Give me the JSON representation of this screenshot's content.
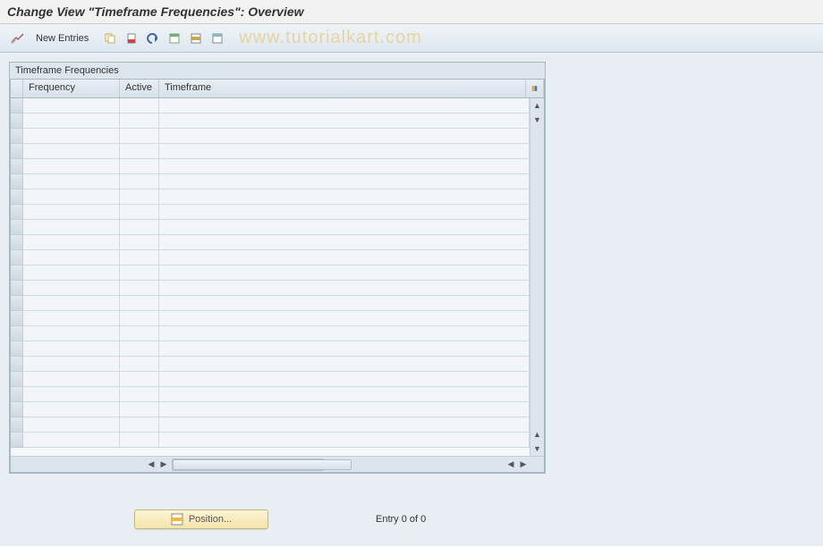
{
  "title": "Change View \"Timeframe Frequencies\": Overview",
  "toolbar": {
    "new_entries_label": "New Entries",
    "icons": {
      "glasses": "display-change-toggle",
      "copy": "copy",
      "delete": "delete",
      "undo": "undo",
      "select_all": "select-all",
      "select_block": "select-block",
      "deselect_all": "deselect-all"
    }
  },
  "watermark": "www.tutorialkart.com",
  "panel": {
    "title": "Timeframe Frequencies",
    "columns": {
      "frequency": "Frequency",
      "active": "Active",
      "timeframe": "Timeframe"
    },
    "rows": [
      {
        "frequency": "",
        "active": "",
        "timeframe": ""
      },
      {
        "frequency": "",
        "active": "",
        "timeframe": ""
      },
      {
        "frequency": "",
        "active": "",
        "timeframe": ""
      },
      {
        "frequency": "",
        "active": "",
        "timeframe": ""
      },
      {
        "frequency": "",
        "active": "",
        "timeframe": ""
      },
      {
        "frequency": "",
        "active": "",
        "timeframe": ""
      },
      {
        "frequency": "",
        "active": "",
        "timeframe": ""
      },
      {
        "frequency": "",
        "active": "",
        "timeframe": ""
      },
      {
        "frequency": "",
        "active": "",
        "timeframe": ""
      },
      {
        "frequency": "",
        "active": "",
        "timeframe": ""
      },
      {
        "frequency": "",
        "active": "",
        "timeframe": ""
      },
      {
        "frequency": "",
        "active": "",
        "timeframe": ""
      },
      {
        "frequency": "",
        "active": "",
        "timeframe": ""
      },
      {
        "frequency": "",
        "active": "",
        "timeframe": ""
      },
      {
        "frequency": "",
        "active": "",
        "timeframe": ""
      },
      {
        "frequency": "",
        "active": "",
        "timeframe": ""
      },
      {
        "frequency": "",
        "active": "",
        "timeframe": ""
      },
      {
        "frequency": "",
        "active": "",
        "timeframe": ""
      },
      {
        "frequency": "",
        "active": "",
        "timeframe": ""
      },
      {
        "frequency": "",
        "active": "",
        "timeframe": ""
      },
      {
        "frequency": "",
        "active": "",
        "timeframe": ""
      },
      {
        "frequency": "",
        "active": "",
        "timeframe": ""
      },
      {
        "frequency": "",
        "active": "",
        "timeframe": ""
      }
    ]
  },
  "footer": {
    "position_label": "Position...",
    "entry_status": "Entry 0 of 0"
  }
}
